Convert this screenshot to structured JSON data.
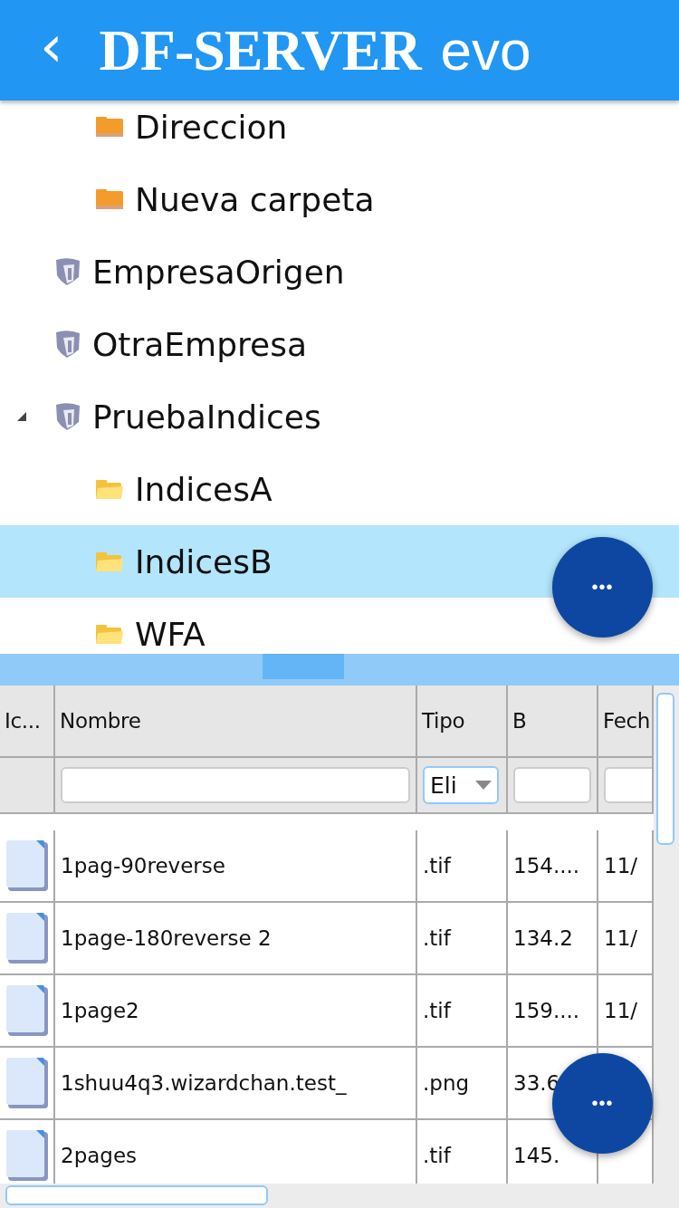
{
  "header": {
    "back": "‹",
    "logo_main": "DF-SERVER",
    "logo_suffix": "evo"
  },
  "tree": {
    "leading": [
      {
        "label": "Direccion",
        "kind": "folder_orange",
        "selected": false
      },
      {
        "label": "Nueva carpeta",
        "kind": "folder_orange",
        "selected": false
      }
    ],
    "items": [
      {
        "label": "EmpresaOrigen",
        "kind": "company",
        "selected": false
      },
      {
        "label": "OtraEmpresa",
        "kind": "company",
        "selected": false
      },
      {
        "label": "PruebaIndices",
        "kind": "company",
        "selected": false,
        "expanded": true,
        "children": [
          {
            "label": "IndicesA",
            "kind": "folder_yellow",
            "selected": false
          },
          {
            "label": "IndicesB",
            "kind": "folder_yellow",
            "selected": true
          },
          {
            "label": "WFA",
            "kind": "folder_yellow",
            "selected": false
          }
        ]
      }
    ]
  },
  "fab_icon": "•••",
  "table": {
    "columns": [
      "Ic...",
      "Nombre",
      "Tipo",
      "B",
      "Fech"
    ],
    "filters": [
      {
        "kind": "none"
      },
      {
        "kind": "text"
      },
      {
        "kind": "select",
        "value": "Eli"
      },
      {
        "kind": "text"
      },
      {
        "kind": "text"
      }
    ],
    "rows": [
      {
        "name": "1pag-90reverse",
        "type": ".tif",
        "size": "154....",
        "date": "11/"
      },
      {
        "name": "1page-180reverse 2",
        "type": ".tif",
        "size": "134.2",
        "date": "11/"
      },
      {
        "name": "1page2",
        "type": ".tif",
        "size": "159....",
        "date": "11/"
      },
      {
        "name": "1shuu4q3.wizardchan.test_",
        "type": ".png",
        "size": "33.6"
      },
      {
        "name": "2pages",
        "type": ".tif",
        "size": "145."
      }
    ]
  }
}
